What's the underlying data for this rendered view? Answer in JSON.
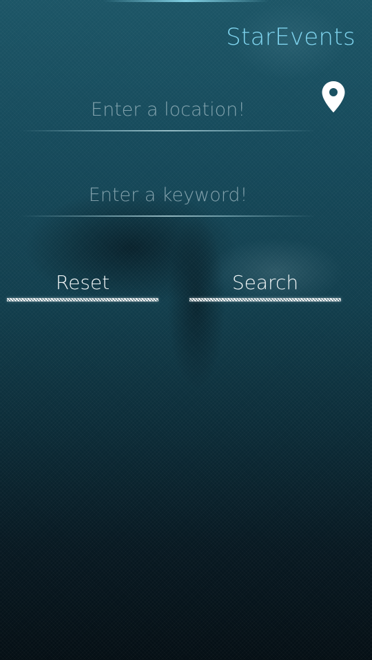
{
  "app": {
    "title": "StarEvents"
  },
  "form": {
    "location": {
      "value": "",
      "placeholder": "Enter a location!"
    },
    "keyword": {
      "value": "",
      "placeholder": "Enter a keyword!"
    }
  },
  "actions": {
    "reset_label": "Reset",
    "search_label": "Search"
  },
  "icons": {
    "location": "map-pin-icon"
  },
  "colors": {
    "accent": "#7fd4ee",
    "text_primary": "#f2f7f8",
    "background_top": "#1c5566",
    "background_bottom": "#050f15"
  }
}
